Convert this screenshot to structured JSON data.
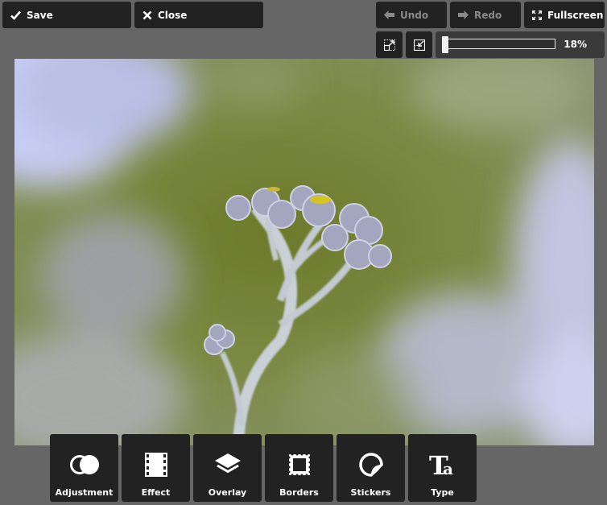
{
  "toolbar": {
    "save_label": "Save",
    "close_label": "Close",
    "undo_label": "Undo",
    "redo_label": "Redo",
    "fullscreen_label": "Fullscreen"
  },
  "zoom": {
    "value_label": "18%",
    "level_percent": 18
  },
  "photo": {
    "subject": "silver-gray flower buds on stem with green bokeh background"
  },
  "tools": [
    {
      "label": "Adjustment",
      "icon": "adjustment-icon"
    },
    {
      "label": "Effect",
      "icon": "film-strip-icon"
    },
    {
      "label": "Overlay",
      "icon": "layers-icon"
    },
    {
      "label": "Borders",
      "icon": "stamp-border-icon"
    },
    {
      "label": "Stickers",
      "icon": "sticker-icon"
    },
    {
      "label": "Type",
      "icon": "type-icon"
    }
  ]
}
